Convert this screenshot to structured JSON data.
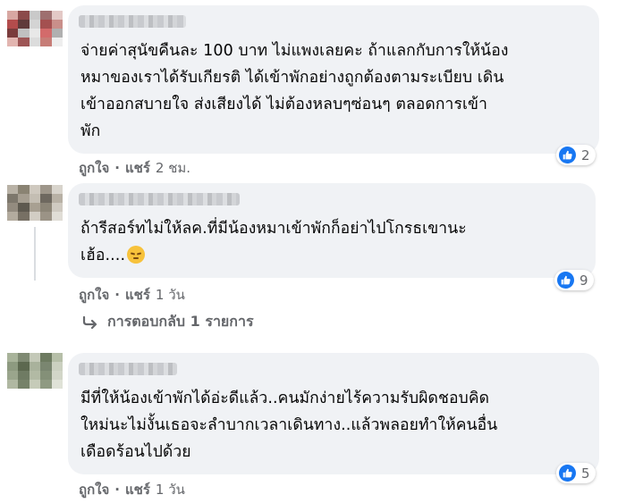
{
  "comments": [
    {
      "text": "จ่ายค่าสุนัขคืนละ 100 บาท ไม่แพงเลยคะ ถ้าแลกกับการให้น้อง\nหมาของเราได้รับเกียรติ ได้เข้าพักอย่างถูกต้องตามระเบียบ เดิน\nเข้าออกสบายใจ ส่งเสียงได้ ไม่ต้องหลบๆซ่อนๆ ตลอดการเข้า\nพัก",
      "reaction_count": "2",
      "like_label": "ถูกใจ",
      "share_label": "แชร์",
      "time": "2 ชม."
    },
    {
      "text": "ถ้ารีสอร์ทไม่ให้ลค.ที่มีน้องหมาเข้าพักก็อย่าไปโกรธเขานะ\nเฮ้อ....",
      "reaction_count": "9",
      "like_label": "ถูกใจ",
      "share_label": "แชร์",
      "time": "1 วัน",
      "replies_label": "การตอบกลับ 1 รายการ"
    },
    {
      "text": "มีที่ให้น้องเข้าพักได้อ่ะดีแล้ว..คนมักง่ายไร้ความรับผิดชอบคิด\nใหม่นะไม่งั้นเธอจะลำบากเวลาเดินทาง..แล้วพลอยทำให้คนอื่น\nเดือดร้อนไปด้วย",
      "reaction_count": "5",
      "like_label": "ถูกใจ",
      "share_label": "แชร์",
      "time": "1 วัน"
    }
  ],
  "separator": "·",
  "icons": {
    "reaction": "like-thumb-icon",
    "reply_arrow": "reply-arrow-icon",
    "emoji": "pensive-face-emoji"
  },
  "colors": {
    "bubble": "#f0f2f5",
    "like_blue": "#1877f2",
    "meta_gray": "#65676b"
  }
}
